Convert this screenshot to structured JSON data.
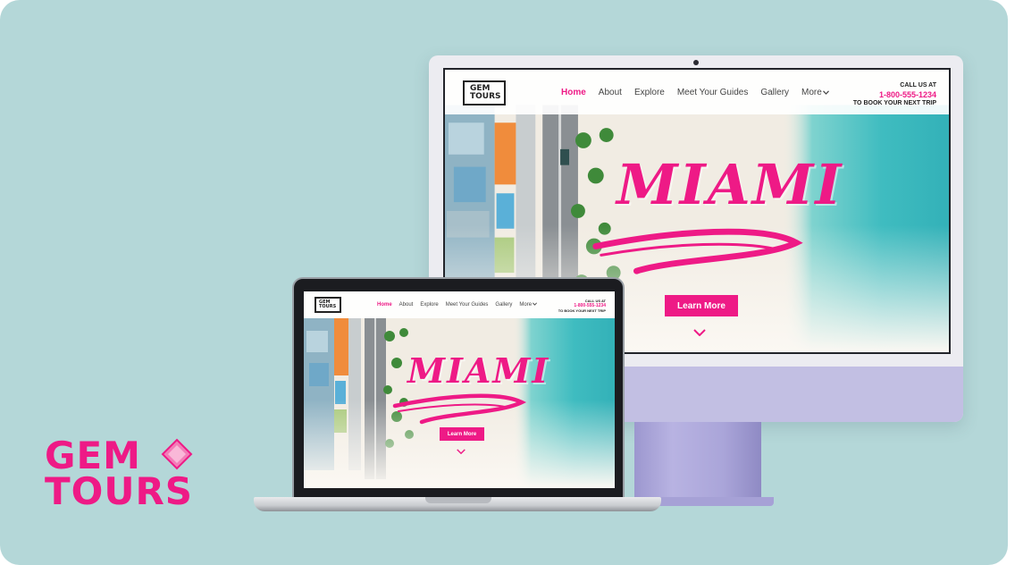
{
  "brand": {
    "line1": "GEM",
    "line2": "TOURS",
    "color": "#ee1a86"
  },
  "site": {
    "logo_line1": "GEM",
    "logo_line2": "TOURS",
    "nav": {
      "home": "Home",
      "about": "About",
      "explore": "Explore",
      "guides": "Meet Your Guides",
      "gallery": "Gallery",
      "more": "More"
    },
    "call": {
      "top": "CALL US AT",
      "phone": "1-800-555-1234",
      "bottom": "TO BOOK YOUR NEXT TRIP"
    },
    "hero_title": "MIAMI",
    "cta": "Learn More",
    "accent": "#ee1a86",
    "icons": [
      "gem-icon",
      "chevron-down-icon"
    ]
  }
}
